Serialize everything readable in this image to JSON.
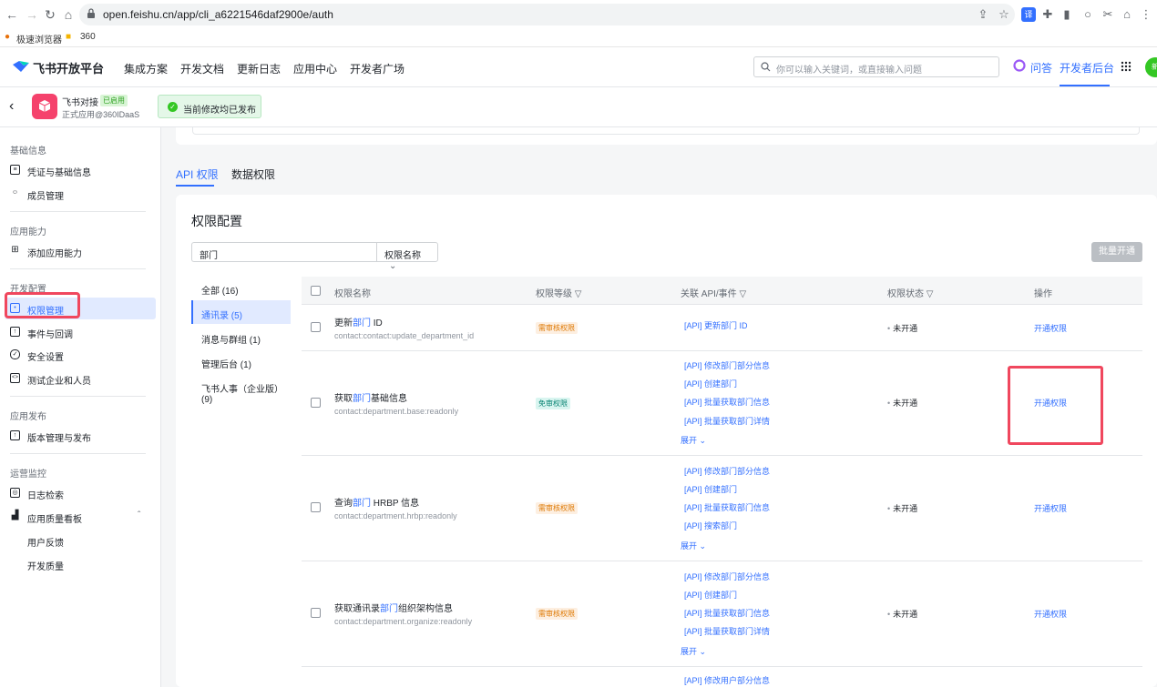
{
  "browser": {
    "url": "open.feishu.cn/app/cli_a6221546daf2900e/auth",
    "bookmarks": [
      "极速浏览器",
      "360"
    ]
  },
  "top_nav": {
    "brand": "飞书开放平台",
    "links": [
      "集成方案",
      "开发文档",
      "更新日志",
      "应用中心",
      "开发者广场"
    ],
    "search_placeholder": "你可以输入关键词，或直接输入问题",
    "qa": "问答",
    "console": "开发者后台",
    "avatar": "新"
  },
  "app": {
    "name": "飞书对接",
    "status": "已启用",
    "subtitle": "正式应用@360IDaaS",
    "banner": "当前修改均已发布"
  },
  "sidebar": {
    "groups": [
      {
        "title": "基础信息",
        "items": [
          "凭证与基础信息",
          "成员管理"
        ]
      },
      {
        "title": "应用能力",
        "items": [
          "添加应用能力"
        ]
      },
      {
        "title": "开发配置",
        "items": [
          "权限管理",
          "事件与回调",
          "安全设置",
          "测试企业和人员"
        ]
      },
      {
        "title": "应用发布",
        "items": [
          "版本管理与发布"
        ]
      },
      {
        "title": "运营监控",
        "items": [
          "日志检索",
          "应用质量看板",
          "用户反馈",
          "开发质量"
        ]
      }
    ]
  },
  "tabs": [
    "API 权限",
    "数据权限"
  ],
  "card": {
    "title": "权限配置",
    "filter_value": "部门",
    "filter_select": "权限名称",
    "bulk_button": "批量开通"
  },
  "categories": [
    "全部 (16)",
    "通讯录 (5)",
    "消息与群组 (1)",
    "管理后台 (1)",
    "飞书人事（企业版）",
    "(9)"
  ],
  "table": {
    "headers": [
      "权限名称",
      "权限等级",
      "关联 API/事件",
      "权限状态",
      "操作"
    ],
    "rows": [
      {
        "name_pre": "更新",
        "name_hl": "部门",
        "name_post": " ID",
        "key": "contact:contact:update_department_id",
        "level": "需审核权限",
        "apis": [
          "[API] 更新部门 ID"
        ],
        "expand": "",
        "status": "未开通",
        "op": "开通权限"
      },
      {
        "name_pre": "获取",
        "name_hl": "部门",
        "name_post": "基础信息",
        "key": "contact:department.base:readonly",
        "level": "免审权限",
        "apis": [
          "[API] 修改部门部分信息",
          "[API] 创建部门",
          "[API] 批量获取部门信息",
          "[API] 批量获取部门详情"
        ],
        "expand": "展开",
        "status": "未开通",
        "op": "开通权限"
      },
      {
        "name_pre": "查询",
        "name_hl": "部门",
        "name_post": " HRBP 信息",
        "key": "contact:department.hrbp:readonly",
        "level": "需审核权限",
        "apis": [
          "[API] 修改部门部分信息",
          "[API] 创建部门",
          "[API] 批量获取部门信息",
          "[API] 搜索部门"
        ],
        "expand": "展开",
        "status": "未开通",
        "op": "开通权限"
      },
      {
        "name_pre": "获取通讯录",
        "name_hl": "部门",
        "name_post": "组织架构信息",
        "key": "contact:department.organize:readonly",
        "level": "需审核权限",
        "apis": [
          "[API] 修改部门部分信息",
          "[API] 创建部门",
          "[API] 批量获取部门信息",
          "[API] 批量获取部门详情"
        ],
        "expand": "展开",
        "status": "未开通",
        "op": "开通权限"
      },
      {
        "apis": [
          "[API] 修改用户部分信息"
        ]
      }
    ]
  },
  "colors": {
    "accent": "#3370ff",
    "highlight": "#f0475e",
    "bg": "#f5f6f7"
  }
}
